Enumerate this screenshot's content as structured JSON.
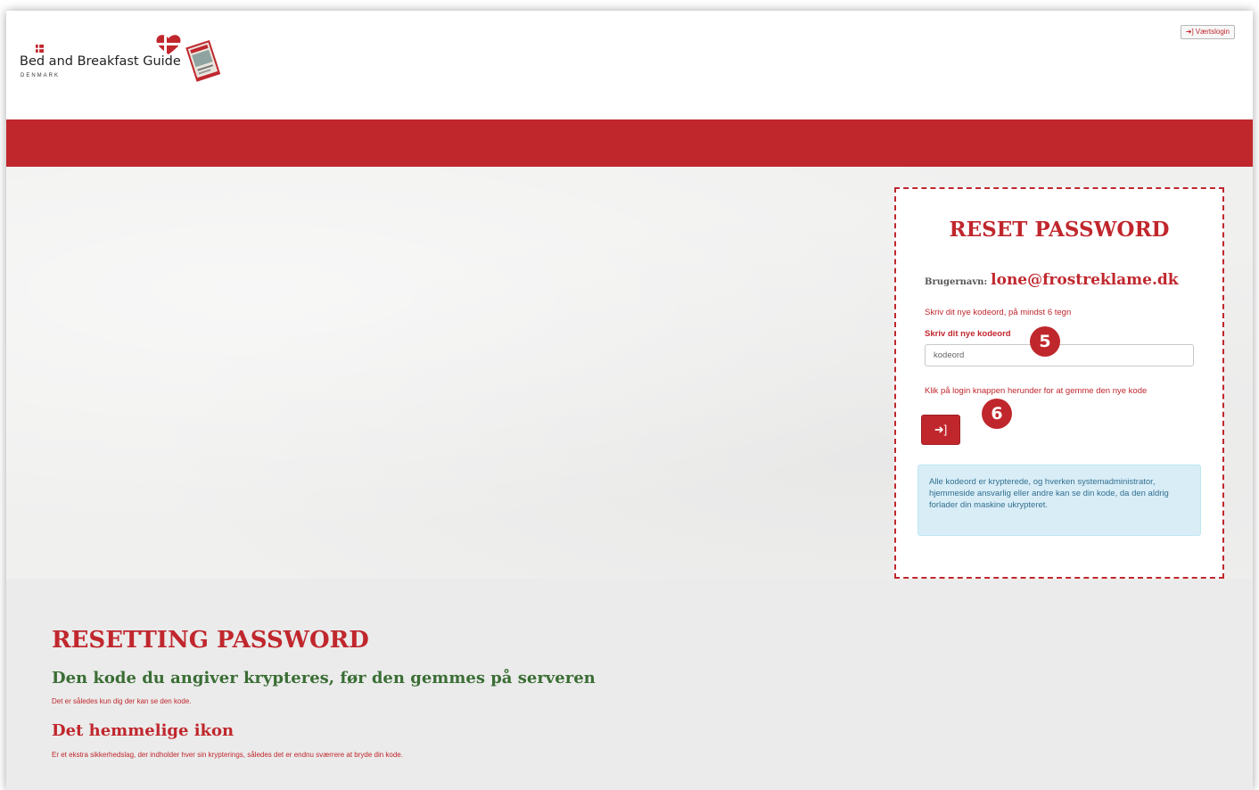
{
  "header": {
    "logo": {
      "name": "Bed and Breakfast Guide",
      "sub": "DENMARK"
    },
    "host_login_label": "Værtslogin",
    "host_login_icon": "sign-in-icon"
  },
  "reset_box": {
    "title": "RESET PASSWORD",
    "username_label": "Brugernavn:",
    "username_value": "lone@frostreklame.dk",
    "hint_min_length": "Skriv dit nye kodeord, på mindst 6 tegn",
    "password_field_label": "Skriv dit nye kodeord",
    "password_placeholder": "kodeord",
    "hint_login": "Klik på login knappen herunder for at gemme den nye kode",
    "login_button_icon": "sign-in-icon",
    "info_text": "Alle kodeord er krypterede, og hverken systemadministrator, hjemmeside ansvarlig eller andre kan se din kode, da den aldrig forlader din maskine ukrypteret."
  },
  "annotations": {
    "step5": "5",
    "step6": "6"
  },
  "lower": {
    "title": "RESETTING PASSWORD",
    "subtitle1": "Den kode du angiver krypteres, før den gemmes på serveren",
    "text1": "Det er således kun dig der kan se den kode.",
    "subtitle2": "Det hemmelige ikon",
    "text2": "Er et ekstra sikkerhedslag, der indholder hver sin krypterings, således det er endnu sværrere at bryde din kode."
  },
  "colors": {
    "brand_red": "#c0272d",
    "green": "#3b6e35",
    "info_bg": "#d9edf7"
  }
}
